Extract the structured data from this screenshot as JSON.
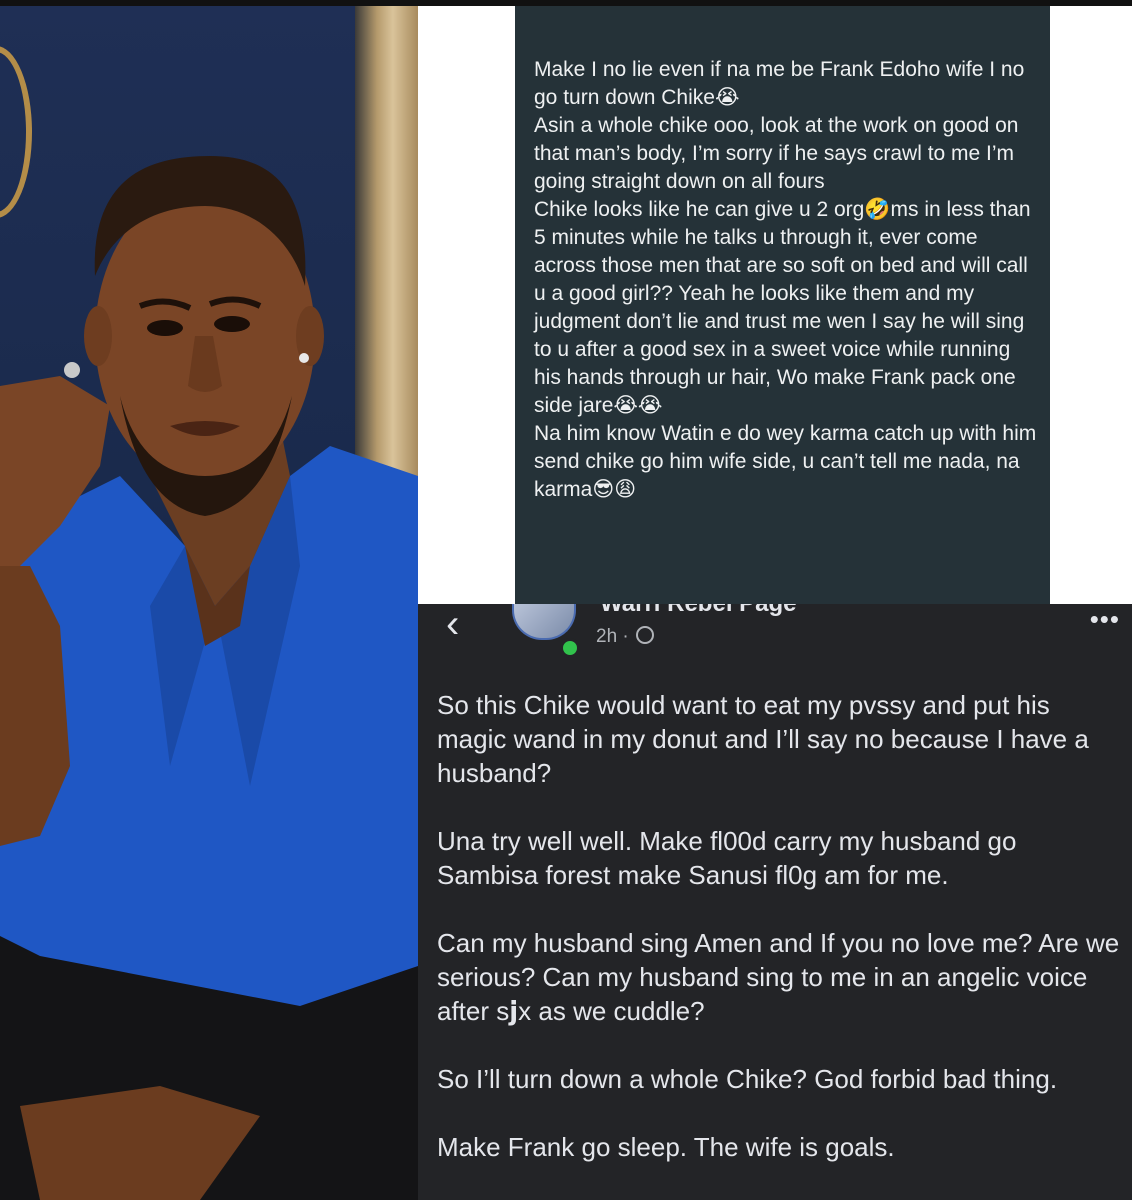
{
  "top_card": {
    "text": "Make I no lie even if na me be Frank Edoho wife I no go turn down Chike😭\nAsin a whole chike ooo, look at the work on good on that man’s body, I’m sorry if he says crawl to me I’m going straight down on all fours\nChike looks like he can give u 2 org🤣ms in less than 5 minutes while he talks u through it, ever come across those men that are so soft on bed and will call u a good girl?? Yeah he looks like them and my judgment don’t lie and trust me wen I say he will sing to u after a good sex in a sweet voice while running his hands through ur hair, Wo make Frank pack one side jare😭😭\nNa him know Watin e do wey karma catch up with him send chike go him wife side, u can’t tell me nada, na karma😎😩"
  },
  "fb_post": {
    "back_icon": "chevron-left-icon",
    "page_name": "Warri Rebel Page",
    "time": "2h ·",
    "more_icon": "more-dots-icon",
    "paragraphs": [
      "So this Chike would want to eat my pvssy and put his magic wand in my donut and I’ll say no because I have a husband?",
      "Una try well well. Make fl00d carry my husband go Sambisa forest make Sanusi fl0g am for me.",
      "Can my husband sing Amen and If you no love me? Are we serious? Can my husband sing to me in an angelic voice after s𝗷x as we cuddle?",
      "So I’ll turn down a whole Chike? God forbid bad thing.",
      "Make Frank go sleep. The wife is goals."
    ]
  },
  "colors": {
    "card_bg": "#253238",
    "fb_bg": "#232427",
    "jacket_blue": "#1f57c4",
    "online_green": "#31c24c"
  }
}
